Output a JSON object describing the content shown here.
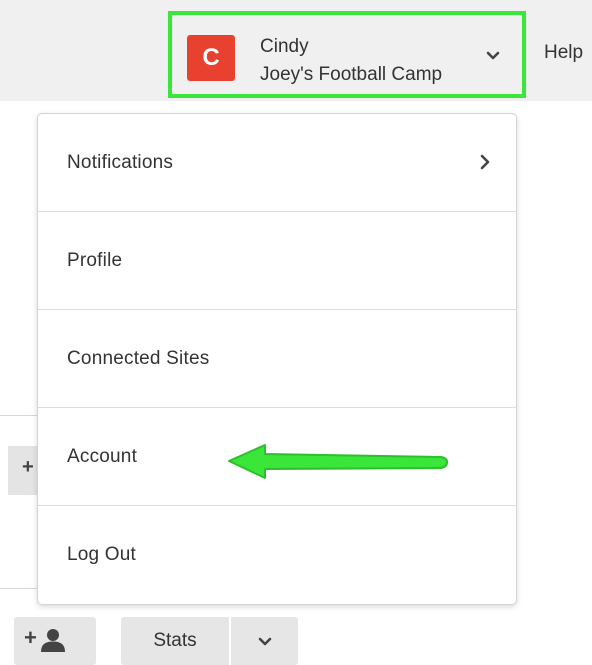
{
  "header": {
    "user": {
      "avatar_letter": "C",
      "name": "Cindy",
      "organization": "Joey's Football Camp"
    },
    "help_label": "Help"
  },
  "menu": {
    "items": [
      {
        "label": "Notifications",
        "has_submenu": true
      },
      {
        "label": "Profile",
        "has_submenu": false
      },
      {
        "label": "Connected Sites",
        "has_submenu": false
      },
      {
        "label": "Account",
        "has_submenu": false
      },
      {
        "label": "Log Out",
        "has_submenu": false
      }
    ]
  },
  "background": {
    "plus_button_glyph": "+",
    "add_person_glyph": "+",
    "stats_label": "Stats"
  },
  "colors": {
    "avatar": "#e8412f",
    "highlight": "#39e639",
    "topbar": "#f0f0f0"
  },
  "icons": {
    "dropdown": "chevron-down-icon",
    "submenu": "chevron-right-icon",
    "add_person": "add-person-icon",
    "annotation": "arrow-left-icon"
  }
}
